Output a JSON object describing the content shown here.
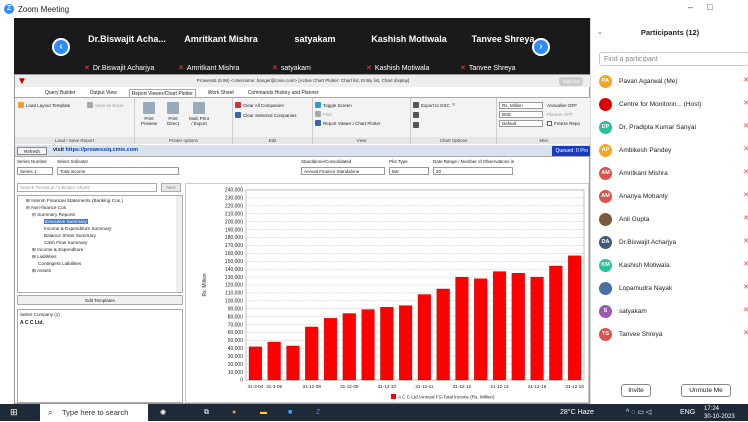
{
  "window": {
    "title": "Zoom Meeting"
  },
  "gallery": {
    "tiles": [
      {
        "name": "Dr.Biswajit Acha...",
        "sub": "Dr.Biswajit Acharjya"
      },
      {
        "name": "Amritkant Mishra",
        "sub": "Amritkant Mishra"
      },
      {
        "name": "satyakam",
        "sub": "satyakam"
      },
      {
        "name": "Kashish Motiwala",
        "sub": "Kashish Motiwala"
      },
      {
        "name": "Tanvee Shreya",
        "sub": "Tanvee Shreya"
      }
    ],
    "prev": "‹",
    "next": "›"
  },
  "app": {
    "titlebar": "Prowess5 (5.96) <Username: banger@cmie.com> [Active Chart Plotter: Chart list, Entity list, Chart display]",
    "signout": "Sign out",
    "tabs": [
      "Query Builder",
      "Output View",
      "Report Viewer/Chart Plotter",
      "Work Sheet",
      "Commands History and Planner"
    ],
    "ribbon": {
      "load_template": "Load Layout Template",
      "save_excel": "Save as Excel",
      "group_load": "Load / Save Report",
      "print_preview": "Print Preview",
      "print_direct": "Print Direct",
      "multi_print": "Multi Print / Export",
      "group_printer": "Printer options",
      "clear_all": "Clear All Companies",
      "clear_selected": "Clear Selected Companies",
      "group_edit": "Edit",
      "toggle_screen": "Toggle Screen",
      "find": "Find",
      "report_viewer": "Report Viewer / Chart Plotter",
      "group_view": "View",
      "export_dsc": "Export to DSC",
      "group_chart": "Chart Options",
      "unit": "Rs. Million",
      "exchange": "BSE",
      "default": "Default",
      "annualise": "Annualise OFF",
      "planner": "Planner OFF",
      "freeze": "Freeze Repo",
      "group_misc": "Misc"
    },
    "urlbar": {
      "refresh": "Refresh",
      "visit": "visit",
      "url": "https://prowessiq.cmie.com",
      "queued": "Queued: 0 Pro"
    },
    "filters": {
      "series_label": "Series Number",
      "series_value": "Series 1",
      "indicator_label": "Select Indicator",
      "indicator_value": "Total income",
      "standalone_label": "Standalone/Consolidated",
      "standalone_value": "Annual Finance Standalone",
      "plot_label": "Plot Type",
      "plot_value": "Bar",
      "date_label": "Date Range / Number of Observations in",
      "date_value": "20"
    },
    "search_placeholder": "Search Technical / Indicator Charts",
    "next_btn": "Next",
    "tree": [
      "⊞ Interim Financial Statements (Banking Cos.)",
      "⊟ Non-finance Cos",
      "⊟ Summary Reports",
      "Executive Summary",
      "Income & Expenditure Summary",
      "Balance Sheet Summary",
      "Cash Flow Summary",
      "⊞ Income & Expenditure",
      "⊞ Liabilities",
      "Contingent Liabilities",
      "⊞ Assets"
    ],
    "edit_templates": "Edit Templates",
    "select_company_label": "Select Company (1)",
    "select_company_value": "A C C Ltd."
  },
  "chart_data": {
    "type": "bar",
    "ylabel": "Rs. Million",
    "ylim": [
      0,
      240000
    ],
    "yticks": [
      0,
      10000,
      20000,
      30000,
      40000,
      50000,
      60000,
      70000,
      80000,
      90000,
      100000,
      110000,
      120000,
      130000,
      140000,
      150000,
      160000,
      170000,
      180000,
      190000,
      200000,
      210000,
      220000,
      230000,
      240000
    ],
    "ytick_labels": [
      "0",
      "10,000",
      "20,000",
      "30,000",
      "40,000",
      "50,000",
      "60,000",
      "70,000",
      "80,000",
      "90,000",
      "100,000",
      "110,000",
      "120,000",
      "130,000",
      "140,000",
      "150,000",
      "160,000",
      "170,000",
      "180,000",
      "190,000",
      "200,000",
      "210,000",
      "220,000",
      "230,000",
      "240,000"
    ],
    "categories": [
      "31-3-04",
      "31-3-05",
      "",
      "31-12-08",
      "",
      "31-12-09",
      "",
      "31-12-10",
      "",
      "31-12-11",
      "",
      "31-12-12",
      "",
      "31-12-14",
      "",
      "31-12-16",
      "",
      "31-12-18"
    ],
    "values": [
      42000,
      48000,
      43000,
      67000,
      78000,
      84000,
      89000,
      92000,
      94000,
      108000,
      115000,
      130000,
      128000,
      137000,
      135000,
      130000,
      144000,
      157000
    ],
    "color": "#ff0000",
    "legend": "A C C Ltd./Annual FS-Total income (Rs. Million)",
    "grid": true
  },
  "taskbar": {
    "search": "Type here to search",
    "weather": "28°C Haze",
    "lang": "ENG",
    "time": "17:24",
    "date": "30-10-2023"
  },
  "panel": {
    "title": "Participants (12)",
    "search_placeholder": "Find a participant",
    "participants": [
      {
        "initials": "PA",
        "color": "#f5a623",
        "name": "Pavan Agarwal (Me)"
      },
      {
        "initials": "",
        "color": "#e00000",
        "name": "Centre for Monitorin... (Host)"
      },
      {
        "initials": "DP",
        "color": "#2dbe9b",
        "name": "Dr. Pradipta Kumar Sanyal"
      },
      {
        "initials": "AP",
        "color": "#f5a623",
        "name": "Ambikesh Pandey"
      },
      {
        "initials": "AM",
        "color": "#d9534f",
        "name": "Amritkant Mishra"
      },
      {
        "initials": "AM",
        "color": "#d9534f",
        "name": "Ananya Mohanty"
      },
      {
        "initials": "",
        "color": "#7a5a3a",
        "name": "Anil Gupta"
      },
      {
        "initials": "DA",
        "color": "#3d5a80",
        "name": "Dr.Biswajit Acharjya"
      },
      {
        "initials": "KM",
        "color": "#2dbe9b",
        "name": "Kashish Motiwala"
      },
      {
        "initials": "",
        "color": "#4a6fa5",
        "name": "Lopamudra Nayak"
      },
      {
        "initials": "S",
        "color": "#9b59b6",
        "name": "satyakam"
      },
      {
        "initials": "TS",
        "color": "#d9534f",
        "name": "Tanvee Shreya"
      }
    ],
    "invite": "Invite",
    "unmute": "Unmute Me"
  }
}
